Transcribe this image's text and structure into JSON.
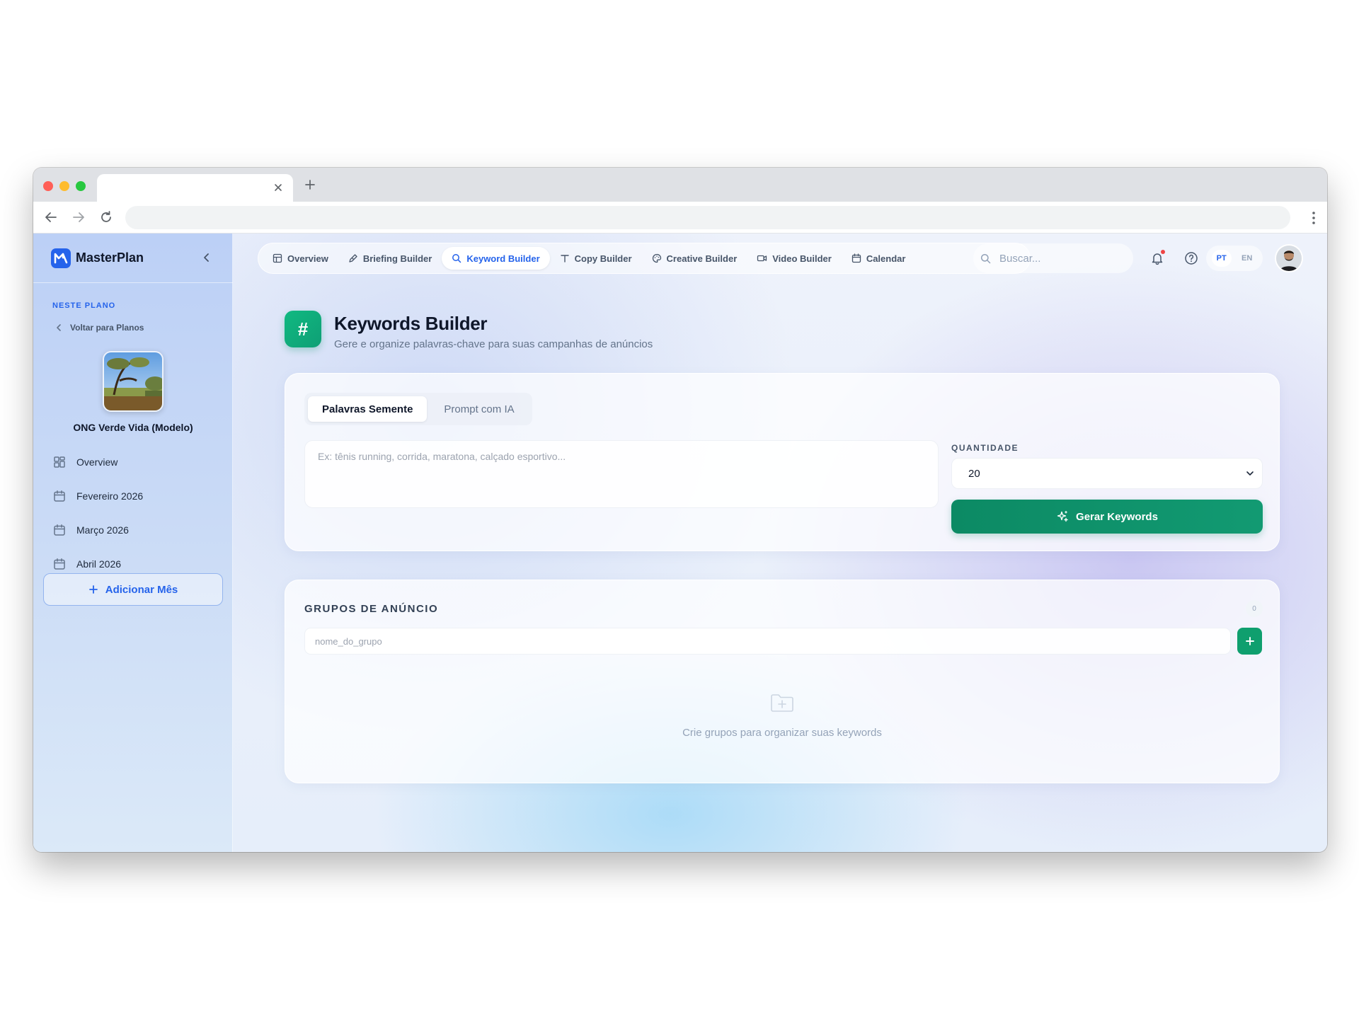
{
  "browser": {
    "tab_title": "",
    "url": ""
  },
  "sidebar": {
    "brand": "MasterPlan",
    "section_label": "NESTE PLANO",
    "back_link": "Voltar para Planos",
    "plan_name": "ONG Verde Vida (Modelo)",
    "items": [
      {
        "label": "Overview",
        "icon": "grid-icon"
      },
      {
        "label": "Fevereiro 2026",
        "icon": "calendar-icon"
      },
      {
        "label": "Março 2026",
        "icon": "calendar-icon"
      },
      {
        "label": "Abril 2026",
        "icon": "calendar-icon"
      }
    ],
    "add_month": "Adicionar Mês"
  },
  "topnav": {
    "tabs": [
      {
        "label": "Overview",
        "icon": "layout-icon",
        "active": false
      },
      {
        "label": "Briefing Builder",
        "icon": "pen-icon",
        "active": false
      },
      {
        "label": "Keyword Builder",
        "icon": "search-icon",
        "active": true
      },
      {
        "label": "Copy Builder",
        "icon": "type-icon",
        "active": false
      },
      {
        "label": "Creative Builder",
        "icon": "palette-icon",
        "active": false
      },
      {
        "label": "Video Builder",
        "icon": "video-icon",
        "active": false
      },
      {
        "label": "Calendar",
        "icon": "calendar-icon",
        "active": false
      }
    ],
    "search_placeholder": "Buscar...",
    "lang": {
      "pt": "PT",
      "en": "EN",
      "active": "PT"
    }
  },
  "page": {
    "icon": "#",
    "title": "Keywords Builder",
    "subtitle": "Gere e organize palavras-chave para suas campanhas de anúncios"
  },
  "input_card": {
    "mode_tabs": [
      "Palavras Semente",
      "Prompt com IA"
    ],
    "active_mode": "Palavras Semente",
    "seed_placeholder": "Ex: tênis running, corrida, maratona, calçado esportivo...",
    "quantity_label": "QUANTIDADE",
    "quantity_value": "20",
    "generate_button": "Gerar Keywords"
  },
  "groups_card": {
    "title": "GRUPOS DE ANÚNCIO",
    "count": "0",
    "group_placeholder": "nome_do_grupo",
    "empty_text": "Crie grupos para organizar suas keywords"
  },
  "colors": {
    "primary_blue": "#2563eb",
    "accent_green": "#0f9f6e",
    "sidebar_bg": "#c9daf6"
  }
}
